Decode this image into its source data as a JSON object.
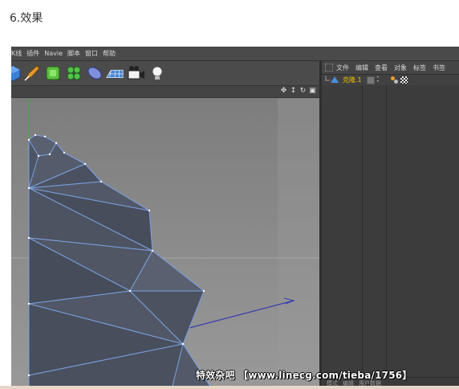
{
  "article": {
    "title": "6.效果"
  },
  "menubar": {
    "items": [
      "K线",
      "插件",
      "Navie",
      "脚本",
      "窗口",
      "帮助"
    ]
  },
  "toolbar": {
    "tools": [
      "cube-icon",
      "pen-icon",
      "subdivision-icon",
      "cloner-icon",
      "deformer-icon",
      "floor-icon",
      "camera-icon",
      "light-icon"
    ]
  },
  "object_manager": {
    "menu": [
      "文件",
      "编辑",
      "查看",
      "对象",
      "标签",
      "书签"
    ],
    "object_name": "克隆.1",
    "bottom_tabs": [
      "模式",
      "编辑",
      "用户数据"
    ]
  },
  "watermark": {
    "text": "特效杂吧 【www.linecg.com/tieba/1756】"
  },
  "colors": {
    "viewport": "#8f8f8f",
    "mesh_fill": "#4f5564",
    "mesh_edge": "#7aa0e0",
    "object_name": "#f0c400"
  }
}
